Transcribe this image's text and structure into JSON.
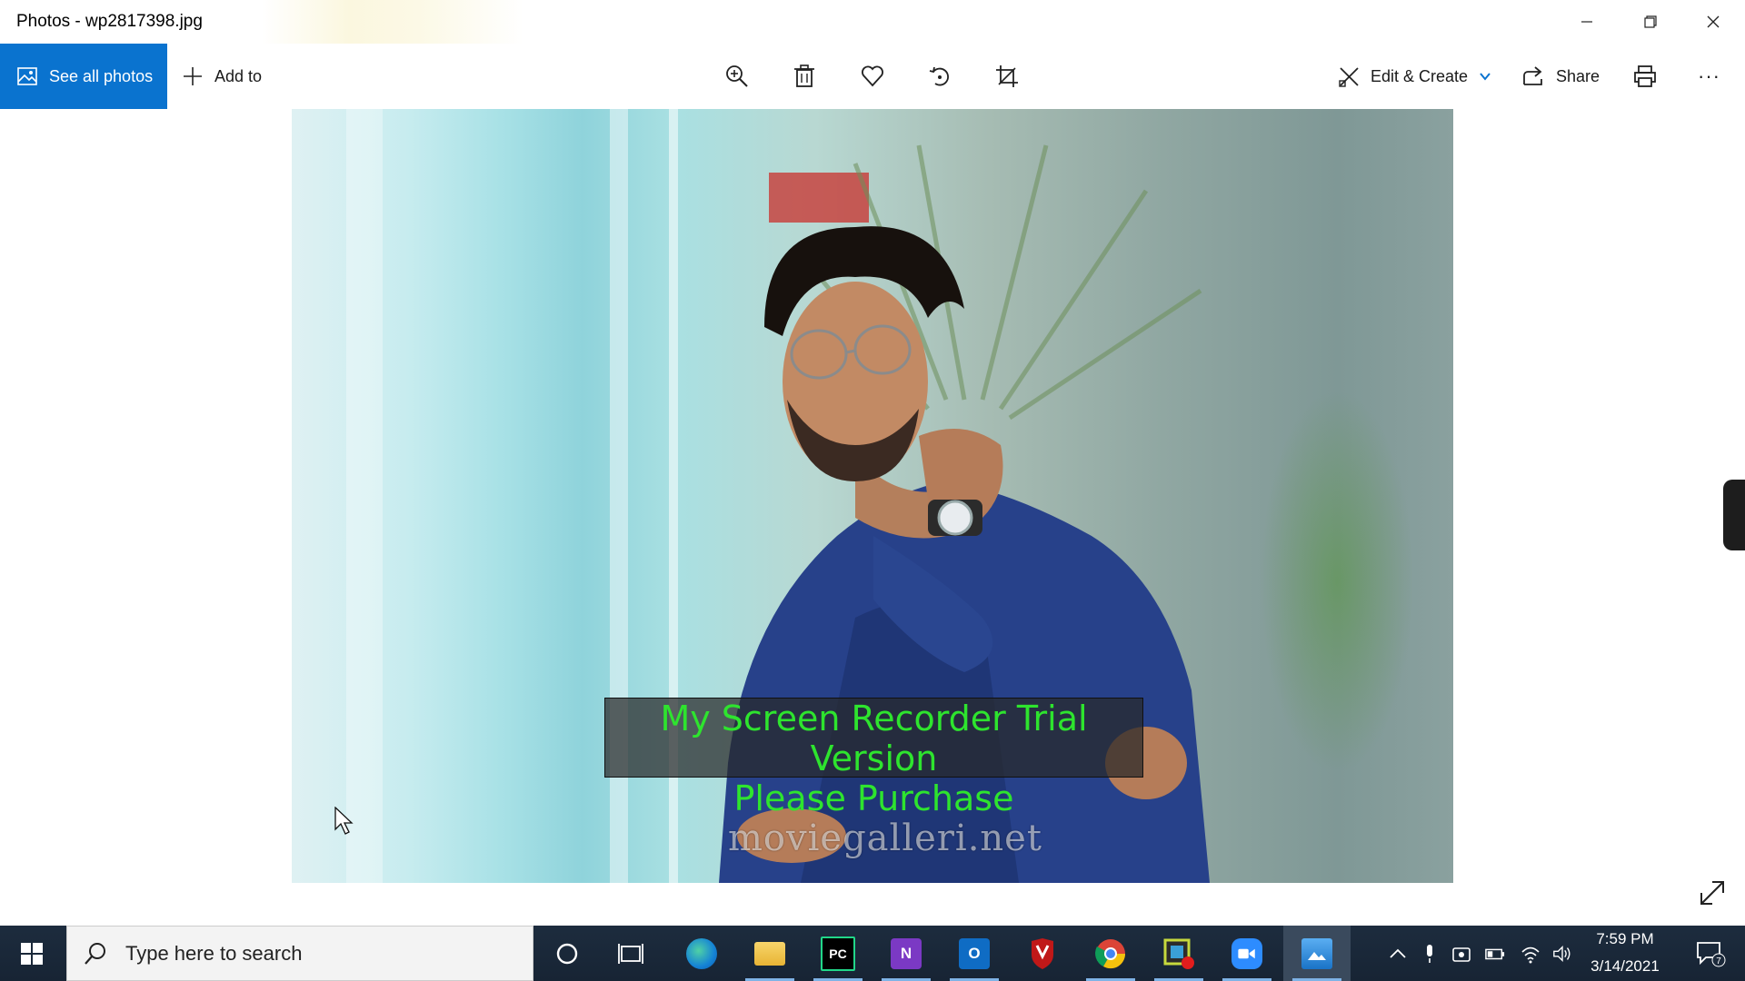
{
  "window": {
    "title": "Photos - wp2817398.jpg",
    "controls": [
      "minimize-icon",
      "restore-icon",
      "close-icon"
    ]
  },
  "toolbar": {
    "see_all_label": "See all photos",
    "add_to_label": "Add to",
    "center_icons": [
      "zoom-in-icon",
      "delete-icon",
      "favorite-icon",
      "rotate-icon",
      "crop-icon"
    ],
    "edit_create_label": "Edit & Create",
    "share_label": "Share",
    "more_label": "···",
    "accent": "#0a73cf"
  },
  "photo": {
    "watermark_site": "moviegalleri.net",
    "recorder_line1": "My Screen Recorder Trial Version",
    "recorder_line2": "Please Purchase",
    "recorder_color": "#2ee42e"
  },
  "taskbar": {
    "search_placeholder": "Type here to search",
    "apps": [
      {
        "name": "cortana-icon"
      },
      {
        "name": "task-view-icon"
      },
      {
        "name": "edge-icon"
      },
      {
        "name": "file-explorer-icon"
      },
      {
        "name": "pycharm-icon",
        "label": "PC"
      },
      {
        "name": "onenote-icon",
        "label": "N"
      },
      {
        "name": "outlook-icon",
        "label": "O"
      },
      {
        "name": "mcafee-icon"
      },
      {
        "name": "chrome-icon"
      },
      {
        "name": "screen-recorder-icon"
      },
      {
        "name": "zoom-icon"
      },
      {
        "name": "photos-icon"
      }
    ],
    "time": "7:59 PM",
    "date": "3/14/2021",
    "notification_count": "7"
  }
}
